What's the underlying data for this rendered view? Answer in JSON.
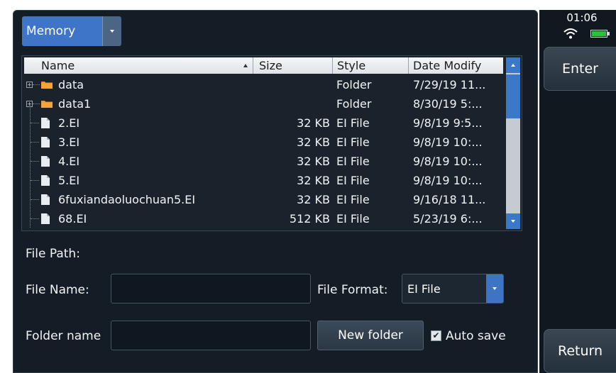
{
  "status": {
    "time": "01:06",
    "wifi_icon": "wifi-icon",
    "battery_icon": "battery-icon",
    "battery_color": "#2cc13d"
  },
  "location": {
    "selected": "Memory"
  },
  "table": {
    "columns": {
      "name": "Name",
      "size": "Size",
      "style": "Style",
      "date": "Date Modify"
    },
    "rows": [
      {
        "name": "data",
        "size": "",
        "style": "Folder",
        "date": "7/29/19 11...",
        "kind": "folder"
      },
      {
        "name": "data1",
        "size": "",
        "style": "Folder",
        "date": "8/30/19 5:...",
        "kind": "folder"
      },
      {
        "name": "2.EI",
        "size": "32 KB",
        "style": "EI File",
        "date": "9/8/19 9:5...",
        "kind": "file"
      },
      {
        "name": "3.EI",
        "size": "32 KB",
        "style": "EI File",
        "date": "9/8/19 10:...",
        "kind": "file"
      },
      {
        "name": "4.EI",
        "size": "32 KB",
        "style": "EI File",
        "date": "9/8/19 10:...",
        "kind": "file"
      },
      {
        "name": "5.EI",
        "size": "32 KB",
        "style": "EI File",
        "date": "9/8/19 10:...",
        "kind": "file"
      },
      {
        "name": "6fuxiandaoluochuan5.EI",
        "size": "32 KB",
        "style": "EI File",
        "date": "9/16/18 11...",
        "kind": "file"
      },
      {
        "name": "68.EI",
        "size": "512 KB",
        "style": "EI File",
        "date": "5/23/19 6:...",
        "kind": "file"
      }
    ]
  },
  "form": {
    "file_path_label": "File Path:",
    "file_name_label": "File Name:",
    "file_name_value": "",
    "file_format_label": "File Format:",
    "file_format_value": "EI File",
    "folder_name_label": "Folder name",
    "folder_name_value": "",
    "new_folder_label": "New folder",
    "auto_save_label": "Auto save",
    "auto_save_checked": true
  },
  "side": {
    "enter_label": "Enter",
    "return_label": "Return"
  },
  "colors": {
    "accent_blue": "#3f75c9",
    "panel_bg": "#141c25"
  }
}
